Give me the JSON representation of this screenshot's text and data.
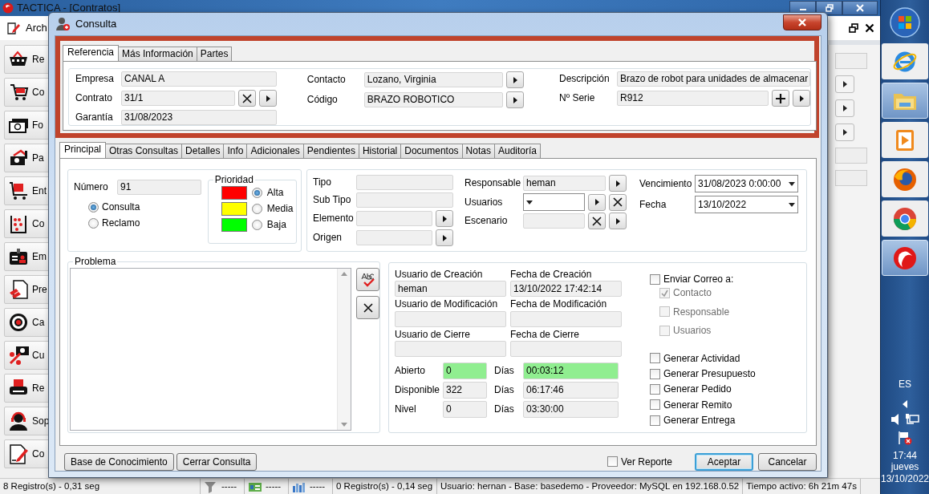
{
  "app": {
    "title": "TACTICA - [Contratos]",
    "menu": "Arch",
    "sidebar": [
      {
        "label": "Re"
      },
      {
        "label": "Co"
      },
      {
        "label": "Fo"
      },
      {
        "label": "Pa"
      },
      {
        "label": "Ent"
      },
      {
        "label": "Co"
      },
      {
        "label": "Em"
      },
      {
        "label": "Pre"
      },
      {
        "label": "Ca"
      },
      {
        "label": "Cu"
      },
      {
        "label": "Re"
      },
      {
        "label": "Sop"
      },
      {
        "label": "Co"
      }
    ],
    "status_bar": [
      {
        "kind": "text",
        "text": "8 Registro(s) - 0,31 seg"
      },
      {
        "kind": "filter",
        "text": "-----"
      },
      {
        "kind": "card",
        "text": "-----"
      },
      {
        "kind": "chart",
        "text": "-----"
      },
      {
        "kind": "text",
        "text": "0 Registro(s) - 0,14 seg"
      },
      {
        "kind": "text",
        "text": "Usuario: hernan - Base: basedemo - Proveedor: MySQL en 192.168.0.52"
      },
      {
        "kind": "text",
        "text": "Tiempo activo: 6h 21m 47s"
      }
    ]
  },
  "dialog": {
    "title": "Consulta",
    "reference_tabs": [
      {
        "label": "Referencia",
        "selected": true
      },
      {
        "label": "Más Información",
        "selected": false
      },
      {
        "label": "Partes",
        "selected": false
      }
    ],
    "reference_columns": [
      [
        {
          "label": "Empresa",
          "value": "CANAL A"
        },
        {
          "label": "Contrato",
          "value": "31/1",
          "buttons": [
            {
              "kind": "clear"
            },
            {
              "kind": "next"
            }
          ]
        },
        {
          "label": "Garantía",
          "value": "31/08/2023"
        }
      ],
      [
        {
          "label": "Contacto",
          "value": "Lozano, Virginia",
          "buttons": [
            {
              "kind": "next"
            }
          ]
        },
        {
          "label": "Código",
          "value": "BRAZO ROBOTICO",
          "buttons": [
            {
              "kind": "next"
            }
          ]
        }
      ],
      [
        {
          "label": "Descripción",
          "value": "Brazo de robot para unidades de almacenar"
        },
        {
          "label": "Nº Serie",
          "value": "R912",
          "buttons": [
            {
              "kind": "add"
            },
            {
              "kind": "next"
            }
          ]
        }
      ]
    ],
    "tabs": [
      {
        "label": "Principal",
        "selected": true
      },
      {
        "label": "Otras Consultas",
        "selected": false
      },
      {
        "label": "Detalles",
        "selected": false
      },
      {
        "label": "Info",
        "selected": false
      },
      {
        "label": "Adicionales",
        "selected": false
      },
      {
        "label": "Pendientes",
        "selected": false
      },
      {
        "label": "Historial",
        "selected": false
      },
      {
        "label": "Documentos",
        "selected": false
      },
      {
        "label": "Notas",
        "selected": false
      },
      {
        "label": "Auditoría",
        "selected": false
      }
    ],
    "number": {
      "label": "Número",
      "value": "91"
    },
    "types": [
      {
        "label": "Consulta",
        "selected": true
      },
      {
        "label": "Reclamo",
        "selected": false
      }
    ],
    "priority": {
      "title": "Prioridad",
      "levels": [
        {
          "label": "Alta",
          "color": "#ff0000",
          "selected": true
        },
        {
          "label": "Media",
          "color": "#ffff00",
          "selected": false
        },
        {
          "label": "Baja",
          "color": "#00ff00",
          "selected": false
        }
      ]
    },
    "classification": [
      {
        "label": "Tipo"
      },
      {
        "label": "Sub Tipo"
      },
      {
        "label": "Elemento",
        "buttons": [
          {
            "kind": "next"
          }
        ]
      },
      {
        "label": "Origen",
        "buttons": [
          {
            "kind": "next"
          }
        ]
      }
    ],
    "assignment": [
      {
        "label": "Responsable",
        "kind": "text",
        "value": "heman",
        "buttons": [
          {
            "kind": "next"
          }
        ]
      },
      {
        "label": "Usuarios",
        "kind": "combo",
        "buttons": [
          {
            "kind": "next"
          },
          {
            "kind": "clear"
          }
        ]
      },
      {
        "label": "Escenario",
        "kind": "text",
        "buttons": [
          {
            "kind": "clear"
          },
          {
            "kind": "next"
          }
        ]
      }
    ],
    "dates": [
      {
        "label": "Vencimiento",
        "kind": "combo",
        "value": "31/08/2023 0:00:00"
      },
      {
        "label": "Fecha",
        "kind": "combo",
        "value": "13/10/2022"
      }
    ],
    "problem": {
      "title": "Problema",
      "tools": [
        {
          "kind": "spellcheck"
        },
        {
          "kind": "clear"
        }
      ]
    },
    "audit": [
      {
        "label": "Usuario de Creación",
        "value": "heman"
      },
      {
        "label": "Fecha de Creación",
        "value": "13/10/2022 17:42:14"
      },
      {
        "label": "Usuario de Modificación"
      },
      {
        "label": "Fecha de Modificación"
      },
      {
        "label": "Usuario de Cierre"
      },
      {
        "label": "Fecha de Cierre"
      }
    ],
    "counters": [
      {
        "label": "Abierto",
        "value": "0",
        "days_label": "Días",
        "days": "00:03:12",
        "highlighted": true
      },
      {
        "label": "Disponible",
        "value": "322",
        "days_label": "Días",
        "days": "06:17:46",
        "highlighted": false
      },
      {
        "label": "Nivel",
        "value": "0",
        "days_label": "Días",
        "days": "03:30:00",
        "highlighted": false
      }
    ],
    "email": {
      "label": "Enviar Correo a:",
      "checked": false,
      "recipients": [
        {
          "label": "Contacto",
          "checked": true,
          "disabled": true
        },
        {
          "label": "Responsable",
          "checked": false,
          "disabled": true
        },
        {
          "label": "Usuarios",
          "checked": false,
          "disabled": true
        }
      ]
    },
    "generate": [
      {
        "label": "Generar Actividad",
        "checked": false
      },
      {
        "label": "Generar Presupuesto",
        "checked": false
      },
      {
        "label": "Generar Pedido",
        "checked": false
      },
      {
        "label": "Generar Remito",
        "checked": false
      },
      {
        "label": "Generar Entrega",
        "checked": false
      }
    ],
    "left_buttons": [
      "Base de Conocimiento",
      "Cerrar Consulta"
    ],
    "report": {
      "label": "Ver Reporte",
      "checked": false
    },
    "buttons": [
      {
        "label": "Aceptar",
        "focused": true
      },
      {
        "label": "Cancelar",
        "focused": false
      }
    ]
  },
  "taskbar": {
    "apps": [
      {
        "running": false
      },
      {
        "running": true
      },
      {
        "running": false
      },
      {
        "running": false
      },
      {
        "running": false
      },
      {
        "running": true
      }
    ],
    "language": "ES",
    "time": "17:44",
    "day": "jueves",
    "date": "13/10/2022"
  }
}
